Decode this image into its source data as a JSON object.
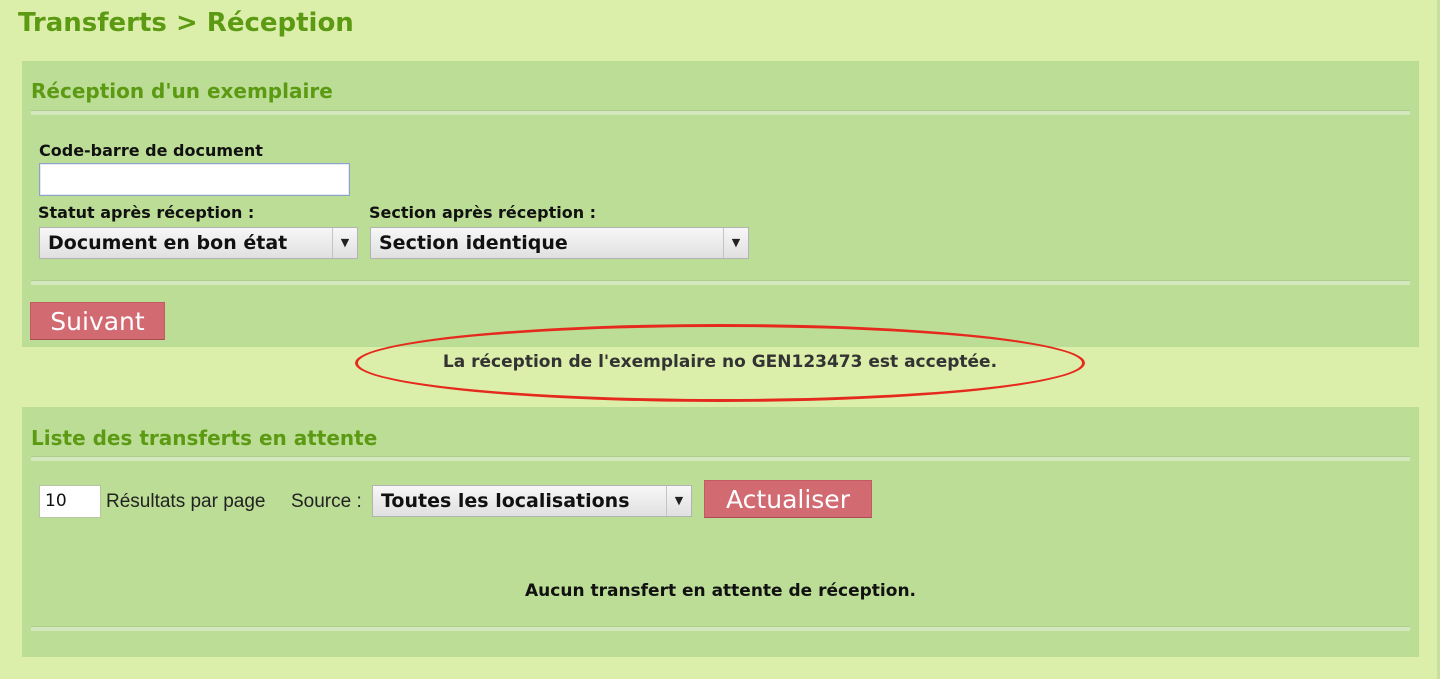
{
  "breadcrumb": "Transferts > Réception",
  "reception": {
    "title": "Réception d'un exemplaire",
    "barcode_label": "Code-barre de document",
    "barcode_value": "",
    "status_label": "Statut après réception :",
    "status_selected": "Document en bon état",
    "section_label": "Section après réception :",
    "section_selected": "Section identique",
    "next_button": "Suivant"
  },
  "message": "La réception de l'exemplaire no GEN123473 est acceptée.",
  "pending": {
    "title": "Liste des transferts en attente",
    "per_page_value": "10",
    "per_page_label": "Résultats par page",
    "source_label": "Source :",
    "source_selected": "Toutes les localisations",
    "refresh_button": "Actualiser",
    "empty_message": "Aucun transfert en attente de réception."
  },
  "colors": {
    "background": "#dcefaa",
    "panel": "#bcdd96",
    "title_green": "#5b9a12",
    "button": "#d26a72",
    "annotation_red": "#e52a1d"
  }
}
